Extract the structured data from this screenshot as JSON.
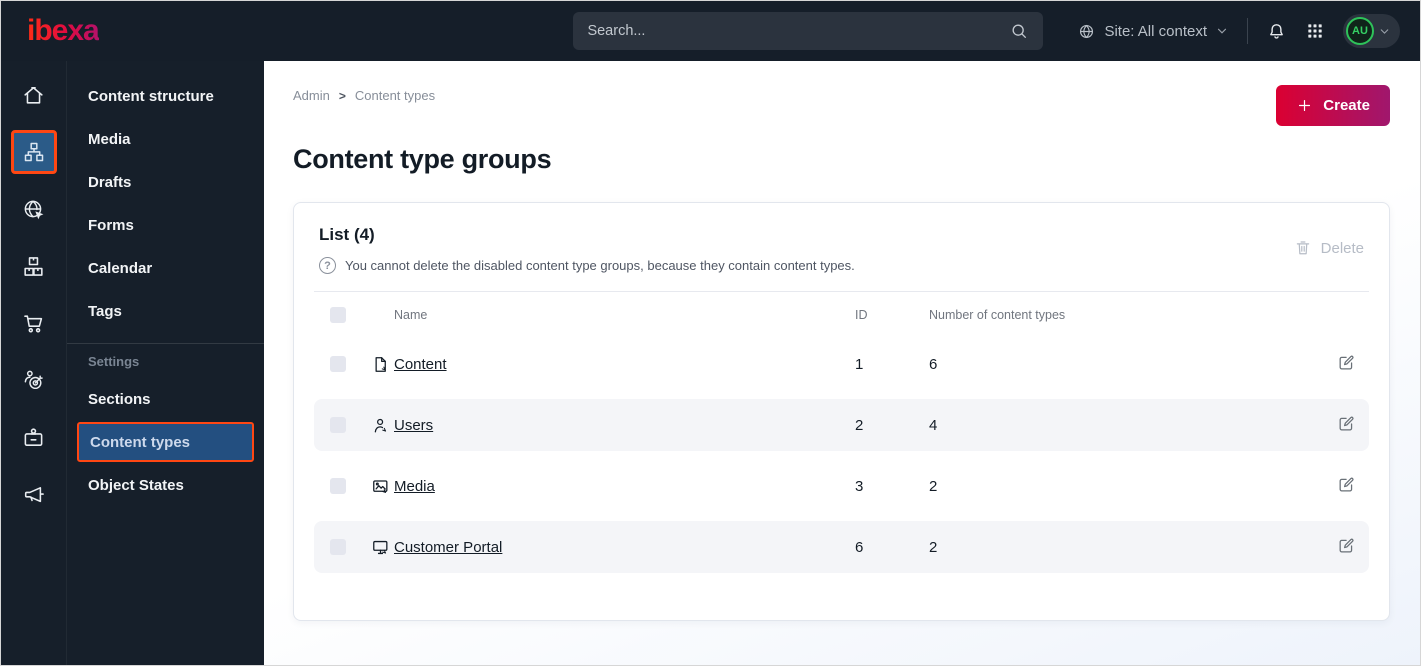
{
  "colors": {
    "topbar_bg": "#151e29",
    "accent_orange": "#ff4713",
    "active_blue": "#2b5b88",
    "primary_red": "#db0032",
    "gradient_end": "#a0176d",
    "avatar_green": "#2ec35a"
  },
  "topbar": {
    "logo": "ibexa",
    "search_placeholder": "Search...",
    "site_context_label": "Site: All context",
    "avatar_initials": "AU",
    "icons": [
      "globe-icon",
      "chevron-down-icon",
      "bell-icon",
      "app-grid-icon"
    ]
  },
  "rail": {
    "items": [
      "home-icon",
      "sitemap-icon",
      "site-globe-icon",
      "product-catalog-icon",
      "cart-icon",
      "personalization-icon",
      "admin-badge-icon",
      "campaign-megaphone-icon"
    ],
    "active_index": 1
  },
  "sidebar": {
    "items": [
      "Content structure",
      "Media",
      "Drafts",
      "Forms",
      "Calendar",
      "Tags"
    ],
    "settings_label": "Settings",
    "settings_items": [
      "Sections",
      "Content types",
      "Object States"
    ],
    "active_item": "Content types"
  },
  "breadcrumb": {
    "items": [
      "Admin",
      "Content types"
    ],
    "separator": ">"
  },
  "header": {
    "create_label": "Create",
    "page_title": "Content type groups"
  },
  "list": {
    "title": "List (4)",
    "help_glyph": "?",
    "help_text": "You cannot delete the disabled content type groups, because they contain content types.",
    "delete_label": "Delete",
    "columns": [
      "Name",
      "ID",
      "Number of content types"
    ],
    "rows": [
      {
        "icon": "file-icon",
        "name": "Content",
        "id": "1",
        "count": "6"
      },
      {
        "icon": "user-icon",
        "name": "Users",
        "id": "2",
        "count": "4"
      },
      {
        "icon": "image-icon",
        "name": "Media",
        "id": "3",
        "count": "2"
      },
      {
        "icon": "monitor-icon",
        "name": "Customer Portal",
        "id": "6",
        "count": "2"
      }
    ]
  }
}
